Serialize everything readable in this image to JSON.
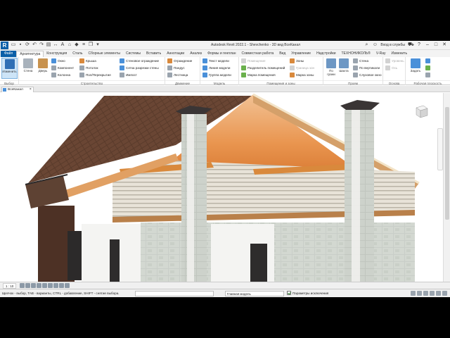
{
  "window": {
    "title": "Autodesk Revit 2022.1 - Shevchenko - 3D вид ВсеКанал",
    "signin_label": "Вход в службы",
    "app_logo_letter": "R"
  },
  "tabs": [
    "Файл",
    "Архитектура",
    "Конструкция",
    "Сталь",
    "Сборные элементы",
    "Системы",
    "Вставить",
    "Аннотации",
    "Анализ",
    "Формы и генплан",
    "Совместная работа",
    "Вид",
    "Управление",
    "Надстройки",
    "ТЕХНОНИКОЛЬ®",
    "V-Ray",
    "Изменить"
  ],
  "active_tab_index": 1,
  "ribbon": {
    "select": {
      "button": "Изменить",
      "title": "Выбор"
    },
    "build": {
      "title": "Строительство",
      "big_buttons": [
        "Стена",
        "Дверь"
      ],
      "col1": [
        "Окно",
        "Компонент",
        "Колонна"
      ],
      "col2": [
        "Крыша",
        "Потолок",
        "Пол/Перекрытие"
      ],
      "col3": [
        "Стеновое ограждение",
        "Сетка разрезки стены",
        "Импост"
      ],
      "col4": [
        "Ограждение",
        "Пандус",
        "Лестница"
      ]
    },
    "circulation": {
      "title": "Движение"
    },
    "model": {
      "title": "Модель",
      "items": [
        "Текст модели",
        "Линия модели",
        "Группа модели"
      ]
    },
    "room": {
      "title": "Помещения и зоны",
      "col1": [
        "Помещение",
        "Разделитель помещений",
        "Марка помещения"
      ],
      "col2": [
        "Зоны",
        "Граница зон",
        "Марка зоны"
      ]
    },
    "opening": {
      "title": "Проем",
      "big_buttons": [
        "По грани",
        "Шахта"
      ],
      "items": [
        "Стена",
        "По вертикали",
        "Слуховое окно"
      ]
    },
    "datum": {
      "title": "Основа",
      "items": [
        "Уровень",
        "Ось"
      ]
    },
    "workplane": {
      "title": "Рабочая плоскость",
      "big_buttons": [
        "Задать"
      ]
    }
  },
  "view": {
    "tab_label": "ВсеКанал",
    "scale": "1 : 10"
  },
  "status": {
    "hint": "Щелчок - выбор, TAB - варианты, CTRL - добавление, SHIFT - снятие выбора.",
    "workset_value": "",
    "model_value": "Главная модель",
    "exclude_options_label": "Параметры исключения"
  }
}
